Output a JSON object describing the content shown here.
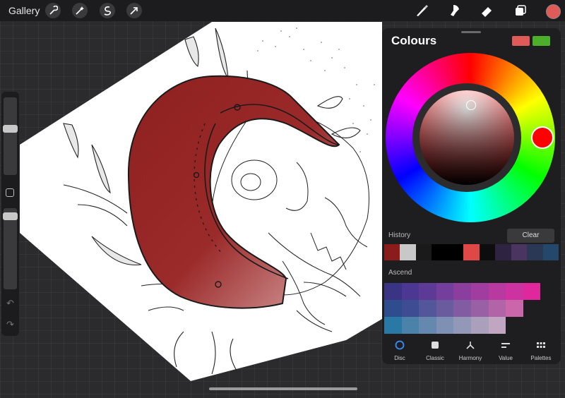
{
  "topbar": {
    "gallery_label": "Gallery",
    "left_icons": [
      "wrench-icon",
      "magic-wand-icon",
      "selection-icon",
      "transform-icon"
    ],
    "right_icons": [
      "brush-icon",
      "smudge-icon",
      "eraser-icon",
      "layers-icon"
    ],
    "current_color": "#e05a5a"
  },
  "colours_panel": {
    "title": "Colours",
    "primary_swatch": "#e05a5a",
    "secondary_swatch": "#4caf2a",
    "history_label": "History",
    "clear_label": "Clear",
    "history_colors": [
      "#8b1c1c",
      "#c8c8c8",
      "#1a1a1a",
      "#000000",
      "#000000",
      "#e04848",
      "#0d0d0d",
      "#2e2340",
      "#4a3460",
      "#2a3856",
      "#24486c"
    ],
    "palette_label": "Ascend",
    "palette_rows": [
      [
        "#3b3484",
        "#4a3892",
        "#5c3a96",
        "#743e9c",
        "#8c3e9e",
        "#a13ca0",
        "#b83aa0",
        "#cc32a0",
        "#e1279c"
      ],
      [
        "#2f4c8e",
        "#3e4c94",
        "#54569a",
        "#6a5a9e",
        "#825ca2",
        "#9a60a6",
        "#b264a8",
        "#cc66aa"
      ],
      [
        "#2a78a6",
        "#4a82aa",
        "#6488ae",
        "#7e90b4",
        "#9498b8",
        "#aaa0bc",
        "#c0a6c0"
      ]
    ],
    "tabs": [
      {
        "label": "Disc",
        "icon": "disc-icon",
        "active": true
      },
      {
        "label": "Classic",
        "icon": "classic-square-icon",
        "active": false
      },
      {
        "label": "Harmony",
        "icon": "harmony-icon",
        "active": false
      },
      {
        "label": "Value",
        "icon": "value-sliders-icon",
        "active": false
      },
      {
        "label": "Palettes",
        "icon": "palettes-grid-icon",
        "active": false
      }
    ]
  }
}
